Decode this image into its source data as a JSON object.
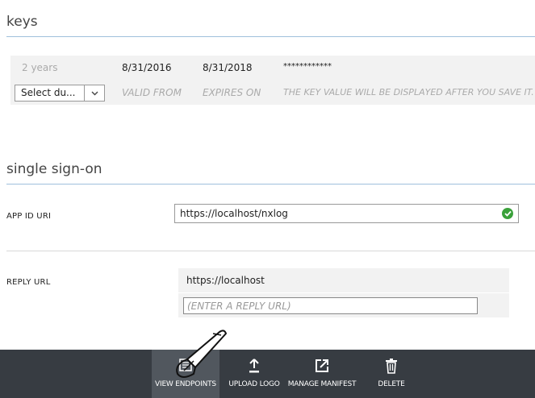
{
  "keys": {
    "title": "keys",
    "row": {
      "duration": "2 years",
      "valid_from": "8/31/2016",
      "expires_on": "8/31/2018",
      "key_value": "************"
    },
    "select": {
      "value": "Select du...",
      "caret": "chevron-down-icon"
    },
    "headers": {
      "valid_from": "VALID FROM",
      "expires_on": "EXPIRES ON",
      "key_value": "THE KEY VALUE WILL BE DISPLAYED AFTER YOU SAVE IT."
    }
  },
  "sso": {
    "title": "single sign-on",
    "app_id_uri": {
      "label": "APP ID URI",
      "value": "https://localhost/nxlog",
      "status_icon": "check-circle-icon"
    },
    "reply_url": {
      "label": "REPLY URL",
      "values": [
        "https://localhost"
      ],
      "placeholder": "(ENTER A REPLY URL)"
    }
  },
  "commands": [
    {
      "label": "VIEW ENDPOINTS",
      "icon": "endpoints-icon",
      "active": true
    },
    {
      "label": "UPLOAD LOGO",
      "icon": "upload-icon",
      "active": false
    },
    {
      "label": "MANAGE MANIFEST",
      "icon": "external-link-icon",
      "active": false
    },
    {
      "label": "DELETE",
      "icon": "trash-icon",
      "active": false
    }
  ],
  "colors": {
    "command_bar": "#373c42",
    "active_command": "#51575e",
    "rule": "#9fc0dc",
    "valid": "#3aa13a"
  }
}
